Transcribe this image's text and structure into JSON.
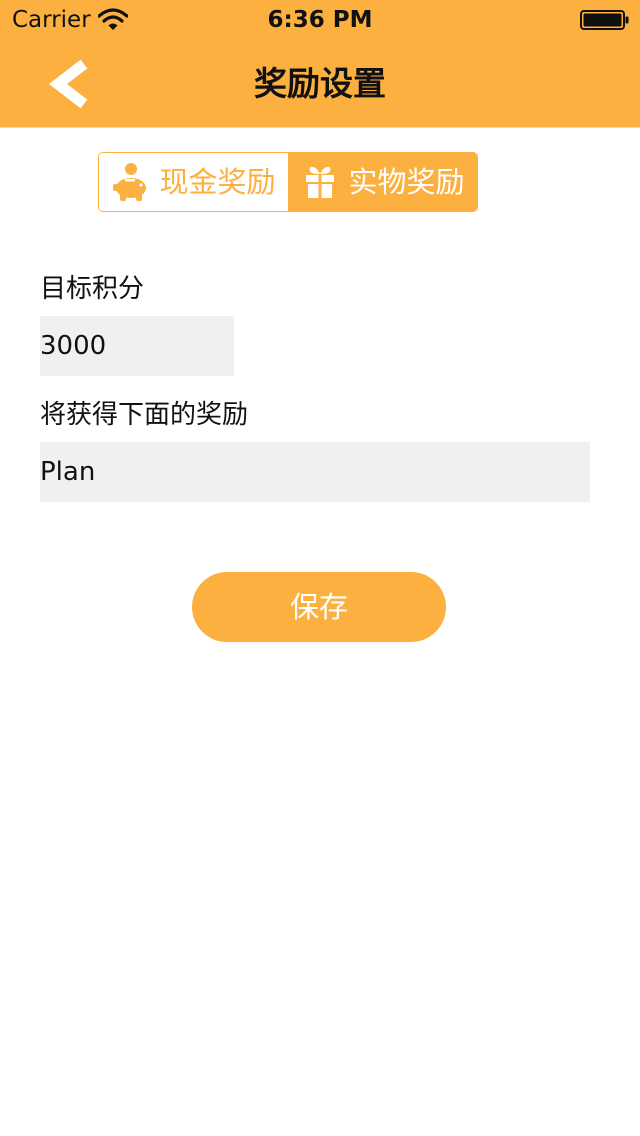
{
  "status_bar": {
    "carrier": "Carrier",
    "time": "6:36 PM",
    "wifi_icon": "wifi-icon",
    "battery_icon": "battery-icon"
  },
  "nav_bar": {
    "title": "奖励设置",
    "back_icon": "chevron-left-icon"
  },
  "reward_type": {
    "options": [
      {
        "label": "现金奖励",
        "icon": "piggy-bank-icon",
        "selected": false
      },
      {
        "label": "实物奖励",
        "icon": "gift-icon",
        "selected": true
      }
    ]
  },
  "form": {
    "target_score_label": "目标积分",
    "target_score_value": "3000",
    "reward_label": "将获得下面的奖励",
    "reward_value": "Plan"
  },
  "save_label": "保存",
  "colors": {
    "accent": "#fbb03f",
    "field_bg": "#f0f0f0",
    "text": "#111111"
  }
}
